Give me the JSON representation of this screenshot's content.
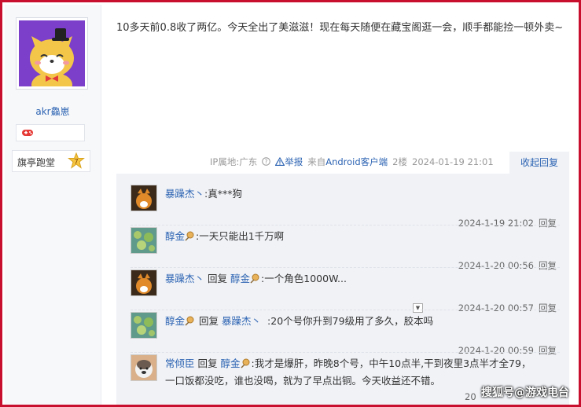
{
  "user": {
    "name": "akr鱻崽",
    "badge_label": "旗亭跑堂",
    "level": "7"
  },
  "post": {
    "text": "10多天前0.8收了两亿。今天全出了美滋滋！现在每天随便在藏宝阁逛一会，顺手都能捡一顿外卖~"
  },
  "meta": {
    "ip": "IP属地:广东",
    "report": "举报",
    "source": "来自Android客户端",
    "floor": "2楼",
    "time": "2024-01-19 21:01",
    "collapse": "收起回复"
  },
  "replies": [
    {
      "name": "暴躁杰丶",
      "mid": "",
      "target": "",
      "text": ":真***狗",
      "time": "2024-1-19 21:02",
      "reply": "回复"
    },
    {
      "name": "醇金",
      "mid": "",
      "target": "",
      "text": ":一天只能出1千万啊",
      "time": "2024-1-20 00:56",
      "reply": "回复"
    },
    {
      "name": "暴躁杰丶",
      "mid": "回复",
      "target": "醇金",
      "text": ":一个角色1000W...",
      "time": "2024-1-20 00:57",
      "reply": "回复"
    },
    {
      "name": "醇金",
      "mid": "回复",
      "target": "暴躁杰丶",
      "text": ":20个号你升到79级用了多久，胶本吗",
      "time": "2024-1-20 00:59",
      "reply": "回复"
    },
    {
      "name": "常倾臣",
      "mid": "回复",
      "target": "醇金",
      "text": ":我才是爆肝，昨晚8个号，中午10点半,干到夜里3点半才全79，一口饭都没吃，谁也没喝，就为了早点出铜。今天收益还不错。",
      "time": "20",
      "reply": ""
    }
  ],
  "watermark": "搜狐号@游戏电台",
  "colors": {
    "link": "#2d64b3",
    "frame": "#c8102e",
    "reply_bg": "#f0f2f6"
  }
}
